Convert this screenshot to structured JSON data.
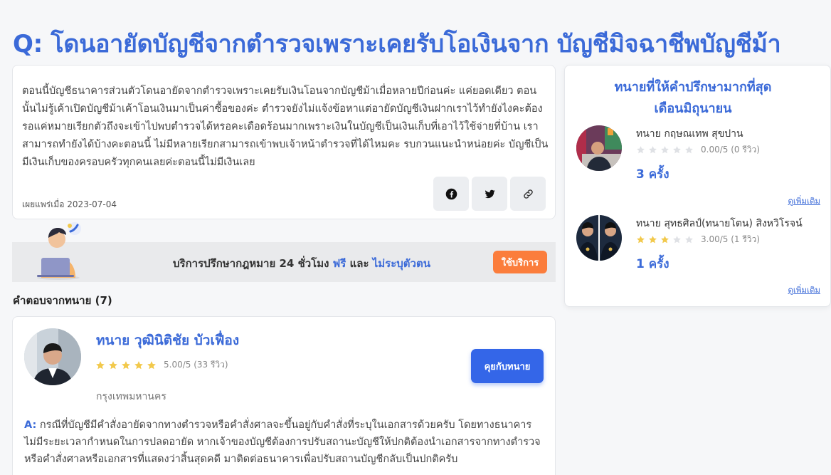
{
  "question": {
    "title": "Q: โดนอายัดบัญชีจากตำรวจเพราะเคยรับโอเงินจาก บัญชีมิจฉาชีพบัญชีม้า",
    "body": "ตอนนี้บัญชีธนาคารส่วนตัวโดนอายัดจากตำรวจเพราะเคยรับเงินโอนจากบัญชีม้าเมื่อหลายปีก่อนค่ะ แค่ยอดเดียว ตอนนั้นไม่รู้เค้าเปิดบัญชีม้าเค้าโอนเงินมาเป็นค่าซื้อของค่ะ ตำรวจยังไม่แจ้งข้อหาแต่อายัดบัญชีเงินฝากเราไว้ทำยังไงคะต้องรอแค่หมายเรียกตัวถึงจะเข้าไปพบตำรวจได้หรอคะเดือดร้อนมากเพราะเงินในบัญชีเป็นเงินเก็บที่เอาไว้ใช้จ่ายที่บ้าน เราสามารถทำยังได้บ้างคะตอนนี้ ไม่มีหลายเรียกสามารถเข้าพบเจ้าหน้าตำรวจที่ได้ไหมคะ รบกวนแนะนำหน่อยค่ะ บัญชีเป็นมีเงินเก็บของครอบครัวทุกคนเลยค่ะตอนนี้ไม่มีเงินเลย",
    "published": "เผยแพร่เมื่อ 2023-07-04",
    "share_icons": [
      "facebook-icon",
      "twitter-icon",
      "link-icon"
    ]
  },
  "service_banner": {
    "text_prefix": "บริการปรึกษากฎหมาย 24 ชั่วโมง ",
    "free": "ฟรี",
    "and": " และ ",
    "anonymous": "ไม่ระบุตัวตน",
    "button": "ใช้บริการ"
  },
  "answers": {
    "heading": "คำตอบจากทนาย (7)",
    "items": [
      {
        "lawyer_name": "ทนาย วุฒินิติชัย บัวเฟื่อง",
        "rating": 5.0,
        "rating_text": "5.00/5 (33 รีวิว)",
        "location": "กรุงเทพมหานคร",
        "chat_button": "คุยกับทนาย",
        "answer_label": "A:",
        "answer_text": " กรณีที่บัญชีมีคำสั่งอายัดจากทางตำรวจหรือคำสั่งศาลจะขึ้นอยู่กับคำสั่งที่ระบุในเอกสารด้วยครับ โดยทางธนาคารไม่มีระยะเวลากำหนดในการปลดอายัด หากเจ้าของบัญชีต้องการปรับสถานะบัญชีให้ปกติต้องนำเอกสารจากทางตำรวจหรือคำสั่งศาลหรือเอกสารที่แสดงว่าสิ้นสุดคดี มาติดต่อธนาคารเพื่อปรับสถานบัญชีกลับเป็นปกติครับ"
      }
    ]
  },
  "sidebar": {
    "title_line1": "ทนายที่ให้คำปรึกษามากที่สุด",
    "title_line2": "เดือนมิถุนายน",
    "lawyers": [
      {
        "name": "ทนาย กฤษณเทพ สุขปาน",
        "rating": 0,
        "rating_text": "0.00/5 (0 รีวิว)",
        "count": "3 ครั้ง",
        "see_more": "ดูเพิ่มเติม"
      },
      {
        "name": "ทนาย สุทธศิลป์(ทนายโตน) สิงหวิโรจน์",
        "rating": 3,
        "rating_text": "3.00/5 (1 รีวิว)",
        "count": "1 ครั้ง",
        "see_more": "ดูเพิ่มเติม"
      }
    ]
  },
  "colors": {
    "accent": "#3b6ad8",
    "button_blue": "#3466e8",
    "button_orange": "#fb7d3c",
    "star_filled": "#f2c94c",
    "star_empty": "#dfe1e5"
  }
}
